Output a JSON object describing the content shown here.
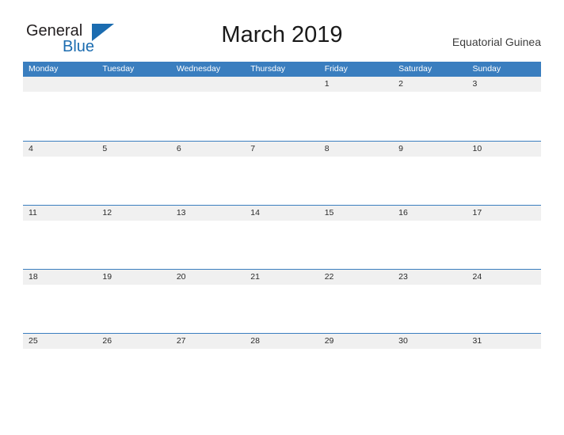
{
  "logo": {
    "line1": "General",
    "line2": "Blue",
    "triangle_color": "#1b6cb0",
    "icon": "triangle-icon"
  },
  "header": {
    "title": "March 2019",
    "subtitle": "Equatorial Guinea"
  },
  "calendar": {
    "accent_color": "#3a7ebf",
    "band_color": "#f0f0f0",
    "weekdays": [
      "Monday",
      "Tuesday",
      "Wednesday",
      "Thursday",
      "Friday",
      "Saturday",
      "Sunday"
    ],
    "weeks": [
      [
        "",
        "",
        "",
        "",
        "1",
        "2",
        "3"
      ],
      [
        "4",
        "5",
        "6",
        "7",
        "8",
        "9",
        "10"
      ],
      [
        "11",
        "12",
        "13",
        "14",
        "15",
        "16",
        "17"
      ],
      [
        "18",
        "19",
        "20",
        "21",
        "22",
        "23",
        "24"
      ],
      [
        "25",
        "26",
        "27",
        "28",
        "29",
        "30",
        "31"
      ]
    ]
  }
}
